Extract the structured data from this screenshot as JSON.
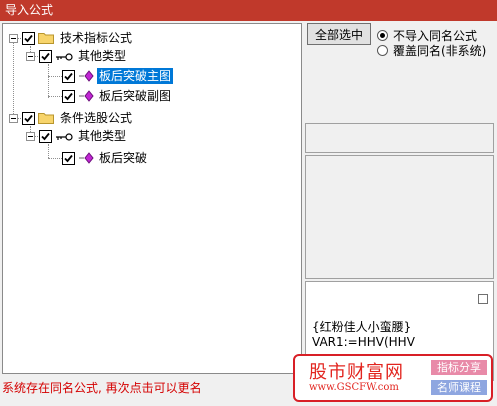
{
  "window": {
    "title": "导入公式",
    "titlebar_color": "#c0392b"
  },
  "tree": {
    "nodes": [
      {
        "label": "技术指标公式",
        "checked": true,
        "kind": "folder",
        "expanded": true
      },
      {
        "label": "其他类型",
        "checked": true,
        "kind": "group",
        "expanded": true
      },
      {
        "label": "板后突破主图",
        "checked": true,
        "kind": "formula",
        "selected": true
      },
      {
        "label": "板后突破副图",
        "checked": true,
        "kind": "formula"
      },
      {
        "label": "条件选股公式",
        "checked": true,
        "kind": "folder",
        "expanded": true
      },
      {
        "label": "其他类型",
        "checked": true,
        "kind": "group",
        "expanded": true
      },
      {
        "label": "板后突破",
        "checked": true,
        "kind": "formula"
      }
    ],
    "selection_color": "#0078d7"
  },
  "options": {
    "select_all_label": "全部选中",
    "radio_skip_label": "不导入同名公式",
    "radio_overwrite_label": "覆盖同名(非系统)",
    "selected_radio": "skip"
  },
  "preview": {
    "line1": "{红粉佳人小蛮腰}",
    "line2": "VAR1:=HHV(HHV"
  },
  "status": {
    "message": "系统存在同名公式, 再次点击可以更名",
    "color": "#d40000"
  },
  "watermark": {
    "logo": "股市财富网",
    "url": "www.GSCFW.com",
    "tag1": "指标分享",
    "tag2": "名师课程",
    "brand_color": "#e2251f"
  }
}
